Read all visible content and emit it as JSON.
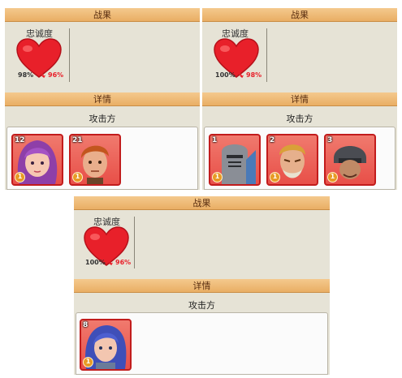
{
  "panels": [
    {
      "title": "战果",
      "loyalty_label": "忠诚度",
      "loyalty_old": "98%",
      "loyalty_new": "96%",
      "details_title": "详情",
      "side_label": "攻击方",
      "heroes": [
        {
          "level": "12",
          "stars": "1",
          "portrait": "purple-hair-girl"
        },
        {
          "level": "21",
          "stars": "1",
          "portrait": "ginger-hair-man"
        }
      ]
    },
    {
      "title": "战果",
      "loyalty_label": "忠诚度",
      "loyalty_old": "100%",
      "loyalty_new": "98%",
      "details_title": "详情",
      "side_label": "攻击方",
      "heroes": [
        {
          "level": "1",
          "stars": "1",
          "portrait": "armored-knight"
        },
        {
          "level": "2",
          "stars": "1",
          "portrait": "blond-old-man"
        },
        {
          "level": "3",
          "stars": "1",
          "portrait": "helmeted-soldier"
        }
      ]
    },
    {
      "title": "战果",
      "loyalty_label": "忠诚度",
      "loyalty_old": "100%",
      "loyalty_new": "96%",
      "details_title": "详情",
      "side_label": "攻击方",
      "heroes": [
        {
          "level": "8",
          "stars": "1",
          "portrait": "blue-hair-woman"
        }
      ]
    }
  ],
  "colors": {
    "header": "#e9ae64",
    "panel_bg": "#e6e3d6",
    "heart": "#e8202a",
    "card_border": "#c21c1c",
    "new_value": "#e8202a"
  }
}
